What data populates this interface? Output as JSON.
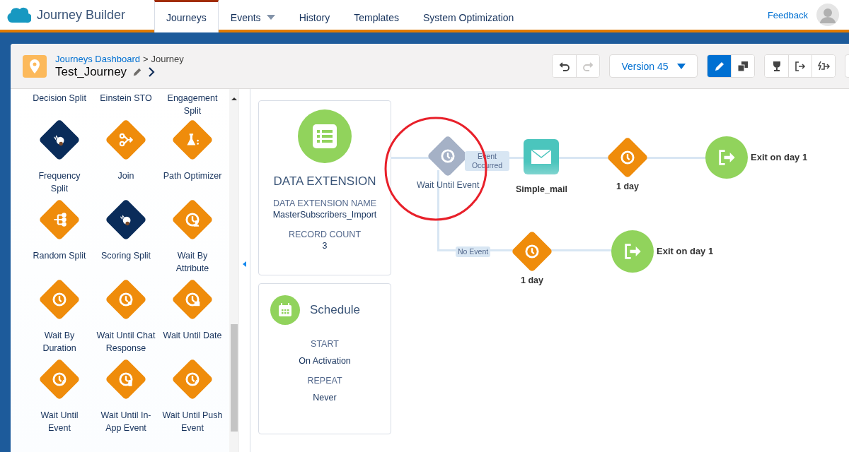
{
  "nav": {
    "brand": "Journey Builder",
    "tabs": [
      {
        "label": "Journeys",
        "selected": true,
        "dropdown": false
      },
      {
        "label": "Events",
        "selected": false,
        "dropdown": true
      },
      {
        "label": "History",
        "selected": false,
        "dropdown": false
      },
      {
        "label": "Templates",
        "selected": false,
        "dropdown": false
      },
      {
        "label": "System Optimization",
        "selected": false,
        "dropdown": false
      }
    ],
    "feedback": "Feedback"
  },
  "header": {
    "breadcrumb": {
      "link": "Journeys Dashboard",
      "separator": ">",
      "current": "Journey"
    },
    "title": "Test_Journey",
    "version": "Version 45",
    "history_tools": [
      {
        "kind": "undo",
        "disabled": false
      },
      {
        "kind": "redo",
        "disabled": true
      }
    ],
    "mode_tools": [
      {
        "kind": "edit",
        "selected": true
      },
      {
        "kind": "copy",
        "selected": false
      }
    ],
    "action_tools": [
      {
        "kind": "goal"
      },
      {
        "kind": "exit"
      },
      {
        "kind": "exit_criteria"
      }
    ]
  },
  "palette": {
    "top_labels": [
      "Decision Split",
      "Einstein STO",
      "Engagement Split"
    ],
    "items": [
      {
        "label": "Frequency Split",
        "kind": "frequency_split"
      },
      {
        "label": "Join",
        "kind": "join"
      },
      {
        "label": "Path Optimizer",
        "kind": "path_optimizer"
      },
      {
        "label": "Random Split",
        "kind": "random_split"
      },
      {
        "label": "Scoring Split",
        "kind": "scoring_split"
      },
      {
        "label": "Wait By Attribute",
        "kind": "wait_attribute"
      },
      {
        "label": "Wait By Duration",
        "kind": "wait"
      },
      {
        "label": "Wait Until Chat Response",
        "kind": "wait_chat"
      },
      {
        "label": "Wait Until Date",
        "kind": "wait_date"
      },
      {
        "label": "Wait Until Event",
        "kind": "wait_event"
      },
      {
        "label": "Wait Until In-App Event",
        "kind": "wait_inapp"
      },
      {
        "label": "Wait Until Push Event",
        "kind": "wait_push"
      }
    ]
  },
  "canvas": {
    "entry": {
      "title": "DATA EXTENSION",
      "fields": [
        {
          "label": "DATA EXTENSION NAME",
          "value": "MasterSubscribers_Import"
        },
        {
          "label": "RECORD COUNT",
          "value": "3"
        }
      ]
    },
    "schedule": {
      "title": "Schedule",
      "fields": [
        {
          "label": "START",
          "value": "On Activation"
        },
        {
          "label": "REPEAT",
          "value": "Never"
        }
      ]
    },
    "flow": {
      "split": {
        "label": "Wait Until Event",
        "kind": "wait_event_gray"
      },
      "branches": [
        {
          "label": "Event Occurred",
          "steps": [
            {
              "kind": "email",
              "label": "Simple_mail"
            },
            {
              "kind": "wait",
              "label": "1 day"
            },
            {
              "kind": "exit",
              "label": "Exit on day 1"
            }
          ]
        },
        {
          "label": "No Event",
          "steps": [
            {
              "kind": "wait",
              "label": "1 day"
            },
            {
              "kind": "exit",
              "label": "Exit on day 1"
            }
          ]
        }
      ]
    }
  }
}
